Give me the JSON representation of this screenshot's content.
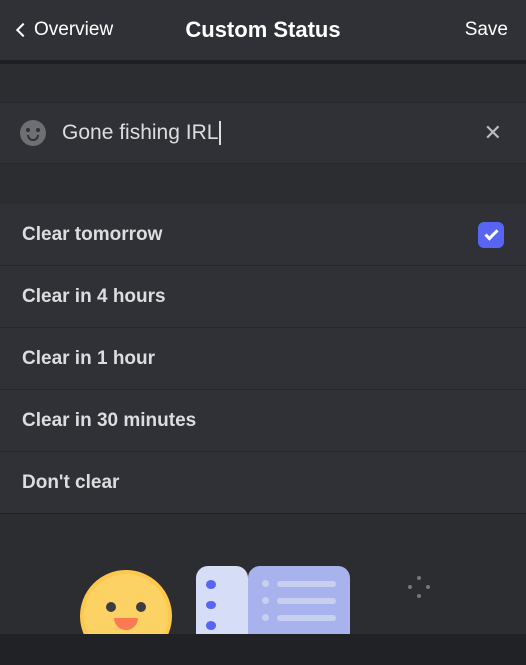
{
  "header": {
    "back_label": "Overview",
    "title": "Custom Status",
    "save_label": "Save"
  },
  "status_input": {
    "value": "Gone fishing IRL",
    "clear_glyph": "✕"
  },
  "clear_options": [
    {
      "label": "Clear tomorrow",
      "selected": true
    },
    {
      "label": "Clear in 4 hours",
      "selected": false
    },
    {
      "label": "Clear in 1 hour",
      "selected": false
    },
    {
      "label": "Clear in 30 minutes",
      "selected": false
    },
    {
      "label": "Don't clear",
      "selected": false
    }
  ]
}
